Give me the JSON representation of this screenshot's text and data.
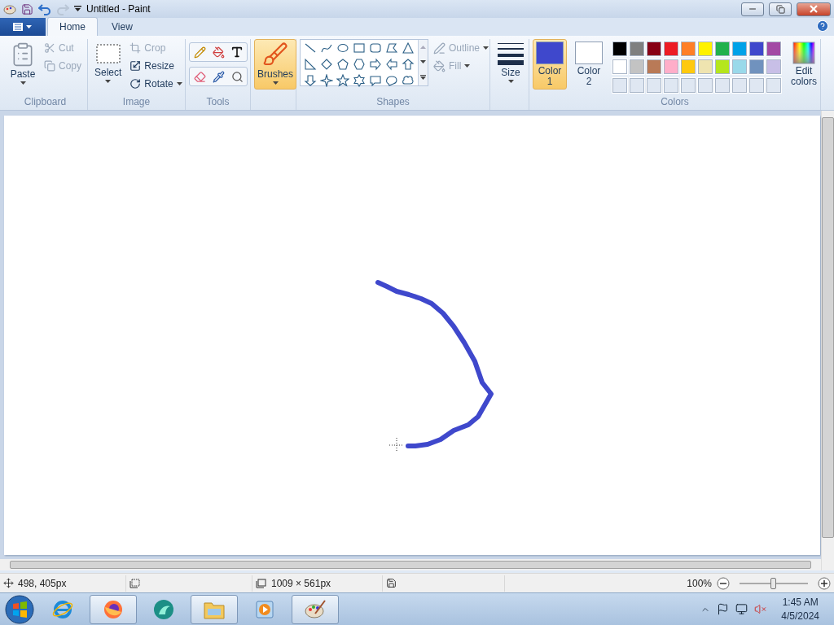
{
  "window": {
    "title": "Untitled - Paint"
  },
  "tabs": [
    {
      "label": "Home",
      "selected": true
    },
    {
      "label": "View",
      "selected": false
    }
  ],
  "clipboard": {
    "label": "Clipboard",
    "paste": "Paste",
    "cut": {
      "label": "Cut",
      "disabled": true
    },
    "copy": {
      "label": "Copy",
      "disabled": true
    }
  },
  "image": {
    "label": "Image",
    "select": "Select",
    "crop": {
      "label": "Crop",
      "disabled": true
    },
    "resize": {
      "label": "Resize",
      "disabled": false
    },
    "rotate": {
      "label": "Rotate",
      "disabled": false
    }
  },
  "tools": {
    "label": "Tools"
  },
  "brushes": {
    "label": "Brushes",
    "selected": true
  },
  "shapes": {
    "label": "Shapes",
    "outline": {
      "label": "Outline",
      "disabled": true
    },
    "fill": {
      "label": "Fill",
      "disabled": true
    }
  },
  "size": {
    "label": "Size"
  },
  "colors": {
    "label": "Colors",
    "color1": {
      "label": "Color\n1",
      "color": "#3f48cc",
      "selected": true
    },
    "color2": {
      "label": "Color\n2",
      "color": "#ffffff",
      "selected": false
    },
    "palette": [
      {
        "color": "#000000"
      },
      {
        "color": "#7f7f7f"
      },
      {
        "color": "#880015"
      },
      {
        "color": "#ed1c24"
      },
      {
        "color": "#ff7f27"
      },
      {
        "color": "#fff200"
      },
      {
        "color": "#22b14c"
      },
      {
        "color": "#00a2e8"
      },
      {
        "color": "#3f48cc"
      },
      {
        "color": "#a349a4"
      },
      {
        "color": "#ffffff"
      },
      {
        "color": "#c3c3c3"
      },
      {
        "color": "#b97a57"
      },
      {
        "color": "#ffaec9"
      },
      {
        "color": "#ffc90e"
      },
      {
        "color": "#efe4b0"
      },
      {
        "color": "#b5e61d"
      },
      {
        "color": "#99d9ea"
      },
      {
        "color": "#7092be"
      },
      {
        "color": "#c8bfe7"
      }
    ],
    "edit": "Edit\ncolors"
  },
  "status_bar": {
    "position": "498, 405px",
    "canvas_size": "1009 × 561px",
    "zoom": "100%",
    "level": 0.5
  },
  "taskbar": {
    "apps": [
      {
        "kind": "ie",
        "running": false
      },
      {
        "kind": "firefox",
        "running": true
      },
      {
        "kind": "teal",
        "running": false
      },
      {
        "kind": "explorer",
        "running": true
      },
      {
        "kind": "media",
        "running": false
      },
      {
        "kind": "paint",
        "running": true
      }
    ],
    "time": "1:45 AM",
    "date": "4/5/2024"
  }
}
